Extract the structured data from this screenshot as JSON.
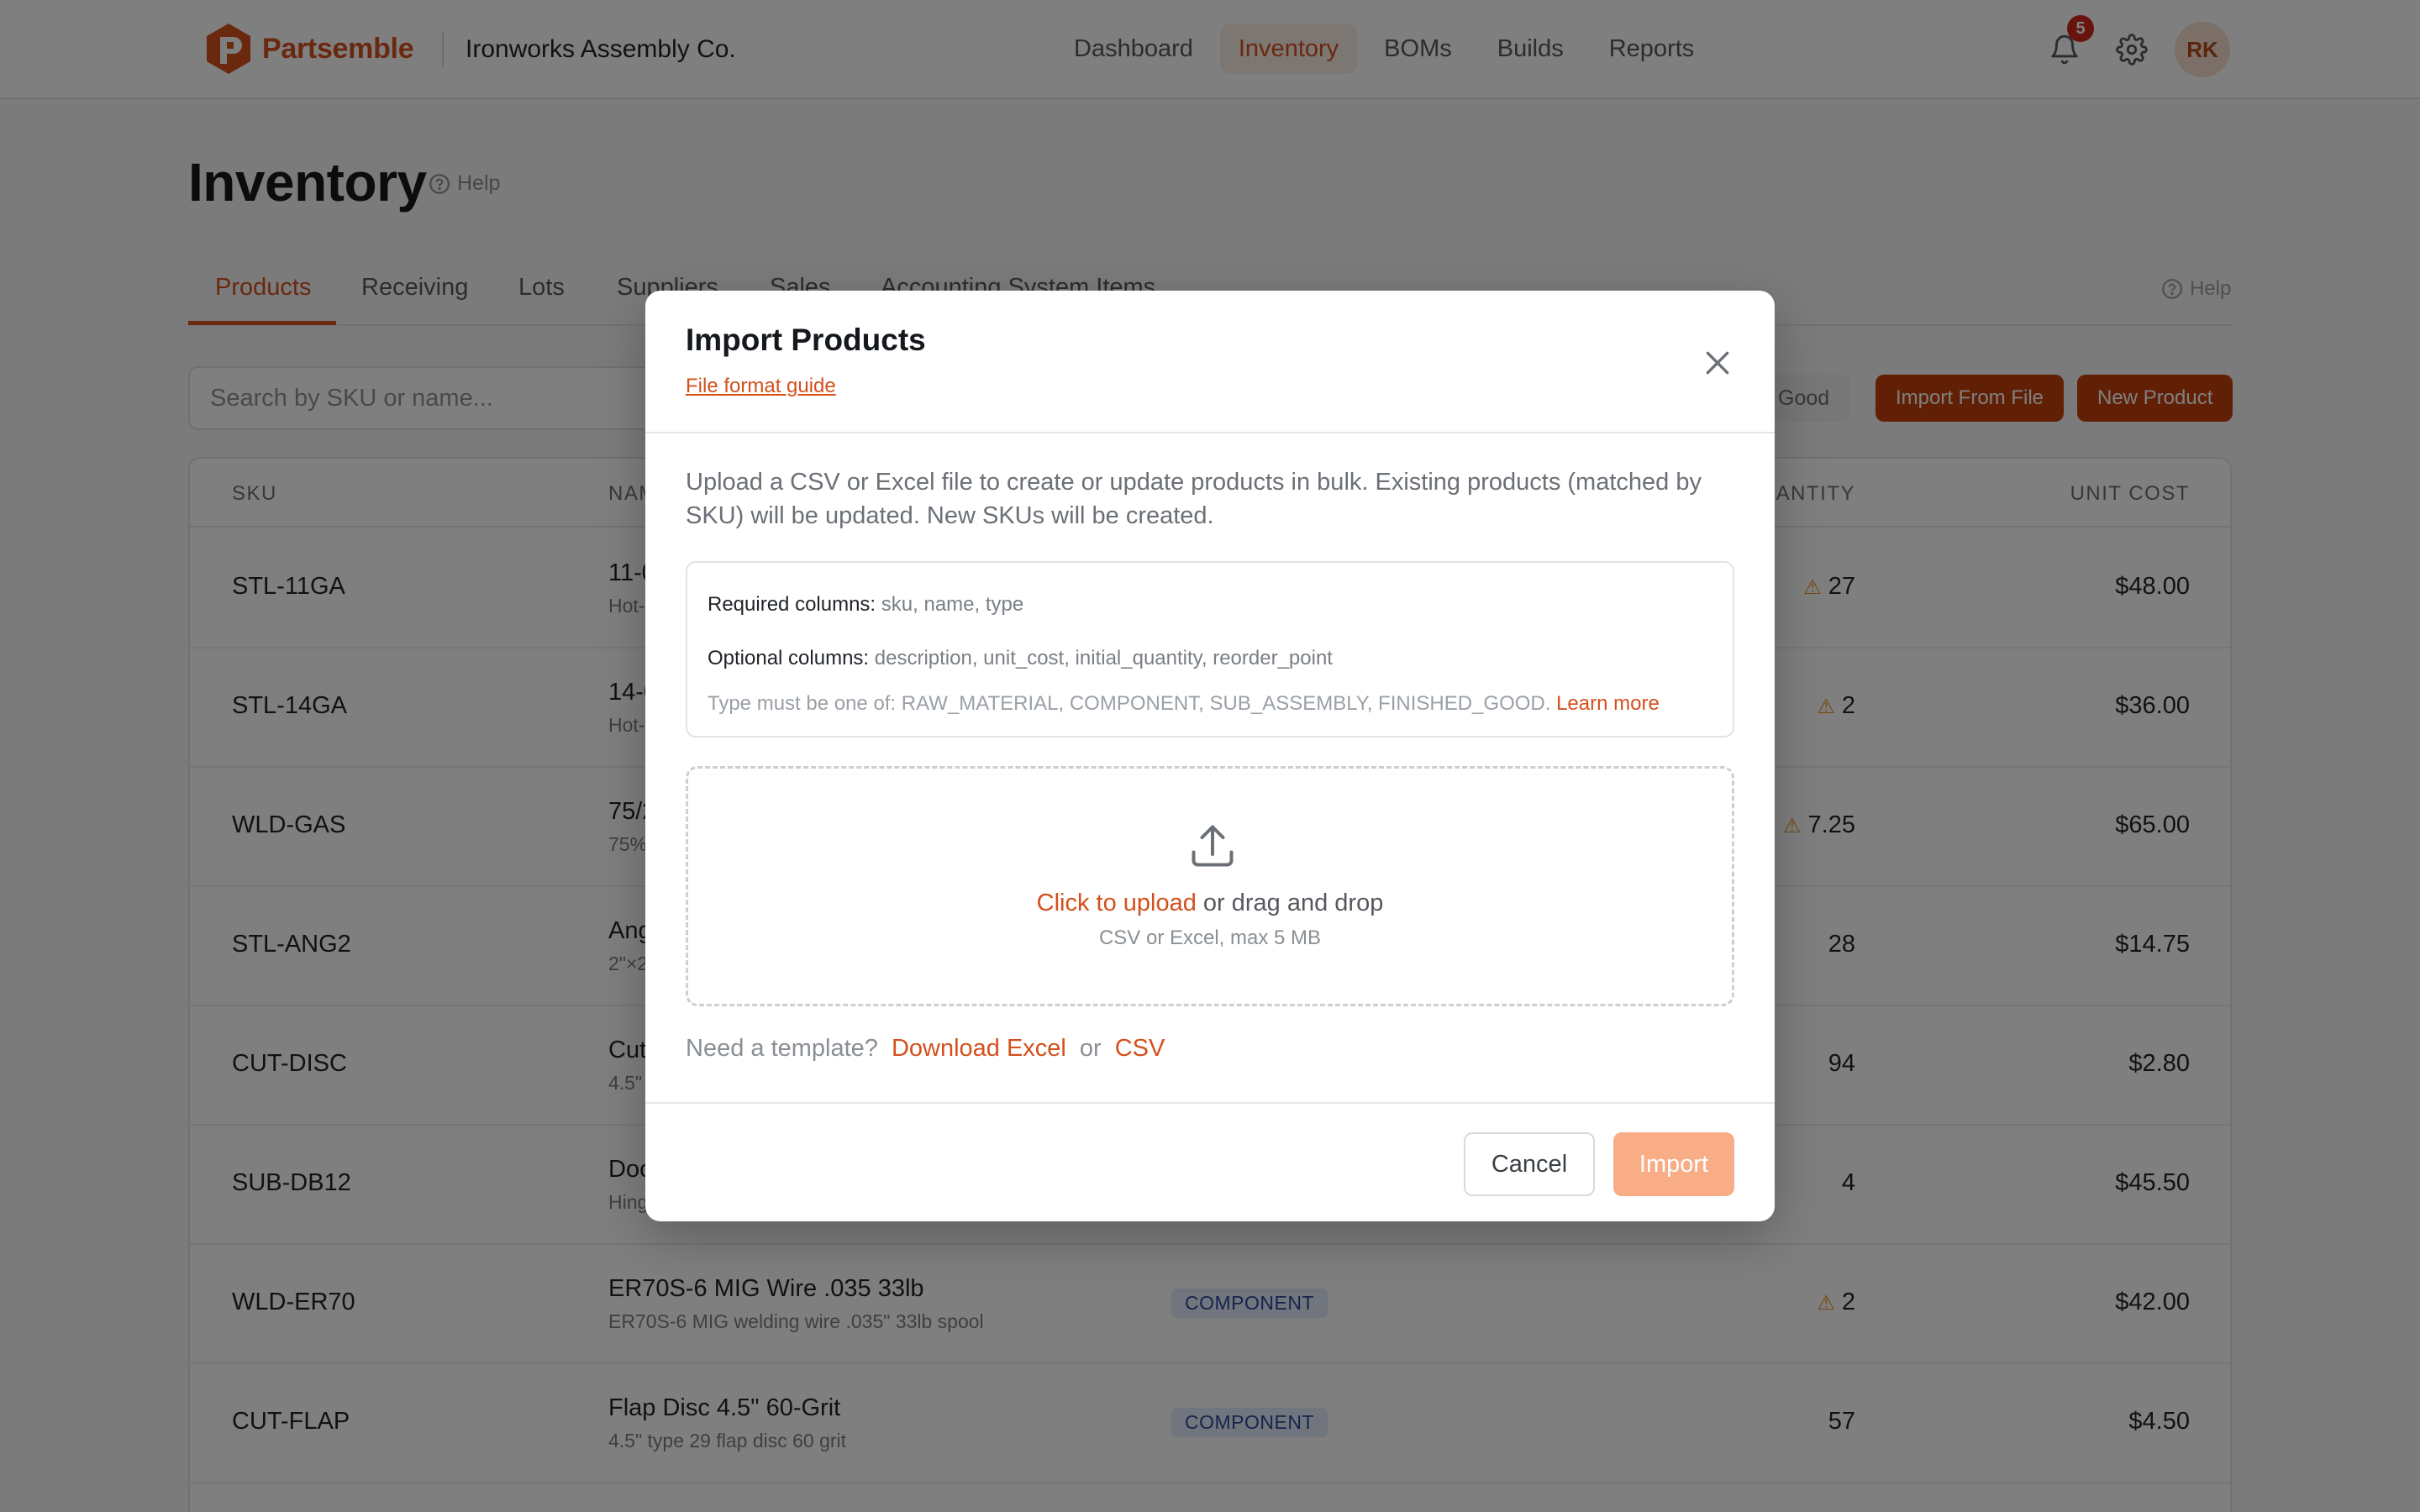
{
  "brand": {
    "name": "Partsemble",
    "org": "Ironworks Assembly Co.",
    "color": "#d4501c"
  },
  "nav": [
    {
      "label": "Dashboard"
    },
    {
      "label": "Inventory"
    },
    {
      "label": "BOMs"
    },
    {
      "label": "Builds"
    },
    {
      "label": "Reports"
    }
  ],
  "header": {
    "notifications": "5",
    "avatar": "RK"
  },
  "page": {
    "title": "Inventory",
    "help": "Help"
  },
  "tabs": [
    {
      "label": "Products"
    },
    {
      "label": "Receiving"
    },
    {
      "label": "Lots"
    },
    {
      "label": "Suppliers"
    },
    {
      "label": "Sales"
    },
    {
      "label": "Accounting System Items"
    }
  ],
  "tabs_help": "Help",
  "toolbar": {
    "search_placeholder": "Search by SKU or name...",
    "filter_chip": "Good",
    "import_label": "Import From File",
    "new_label": "New Product"
  },
  "table": {
    "headers": {
      "sku": "SKU",
      "name": "NAM",
      "quantity": "ANTITY",
      "unit_cost": "UNIT COST"
    },
    "rows": [
      {
        "sku": "STL-11GA",
        "name": "11-0",
        "desc": "Hot-",
        "type": "",
        "qty": "27",
        "warn": true,
        "cost": "$48.00"
      },
      {
        "sku": "STL-14GA",
        "name": "14-0",
        "desc": "Hot-",
        "type": "",
        "qty": "2",
        "warn": true,
        "cost": "$36.00"
      },
      {
        "sku": "WLD-GAS",
        "name": "75/2",
        "desc": "75%",
        "type": "",
        "qty": "7.25",
        "warn": true,
        "cost": "$65.00"
      },
      {
        "sku": "STL-ANG2",
        "name": "Ang",
        "desc": "2\"×2",
        "type": "",
        "qty": "28",
        "warn": false,
        "cost": "$14.75"
      },
      {
        "sku": "CUT-DISC",
        "name": "Cut",
        "desc": "4.5\"",
        "type": "",
        "qty": "94",
        "warn": false,
        "cost": "$2.80"
      },
      {
        "sku": "SUB-DB12",
        "name": "Doo",
        "desc": "Hing",
        "type": "",
        "qty": "4",
        "warn": false,
        "cost": "$45.50"
      },
      {
        "sku": "WLD-ER70",
        "name": "ER70S-6 MIG Wire .035 33lb",
        "desc": "ER70S-6 MIG welding wire .035\" 33lb spool",
        "type": "COMPONENT",
        "qty": "2",
        "warn": true,
        "cost": "$42.00"
      },
      {
        "sku": "CUT-FLAP",
        "name": "Flap Disc 4.5\" 60-Grit",
        "desc": "4.5\" type 29 flap disc 60 grit",
        "type": "COMPONENT",
        "qty": "57",
        "warn": false,
        "cost": "$4.50"
      }
    ]
  },
  "modal": {
    "title": "Import Products",
    "guide_link": "File format guide",
    "intro": "Upload a CSV or Excel file to create or update products in bulk. Existing products (matched by SKU) will be updated. New SKUs will be created.",
    "required_label": "Required columns:",
    "required_value": "sku, name, type",
    "optional_label": "Optional columns:",
    "optional_value": "description, unit_cost, initial_quantity, reorder_point",
    "type_note": "Type must be one of: RAW_MATERIAL, COMPONENT, SUB_ASSEMBLY, FINISHED_GOOD.",
    "learn_more": "Learn more",
    "upload_link": "Click to upload",
    "upload_rest": "or drag and drop",
    "upload_hint": "CSV or Excel, max 5 MB",
    "template_prompt": "Need a template?",
    "template_excel": "Download Excel",
    "template_or": "or",
    "template_csv": "CSV",
    "cancel": "Cancel",
    "import": "Import"
  }
}
